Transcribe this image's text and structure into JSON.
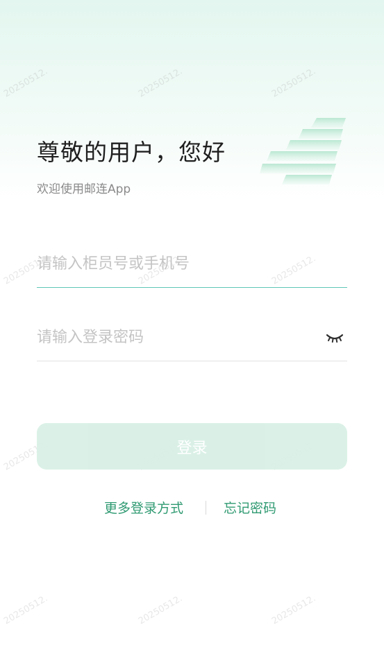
{
  "watermark": {
    "text": "20250512."
  },
  "brand": {
    "logo_icon": "post-logo-icon",
    "accent_color": "#2f9a72",
    "logo_color": "#bfe9d6"
  },
  "header": {
    "title": "尊敬的用户，您好",
    "subtitle": "欢迎使用邮连App"
  },
  "form": {
    "account": {
      "value": "",
      "placeholder": "请输入柜员号或手机号"
    },
    "password": {
      "value": "",
      "placeholder": "请输入登录密码",
      "toggle_icon": "eye-closed-icon"
    },
    "login_label": "登录",
    "login_button_color": "#d9f0e6"
  },
  "footer": {
    "more_login_label": "更多登录方式",
    "forgot_password_label": "忘记密码"
  }
}
